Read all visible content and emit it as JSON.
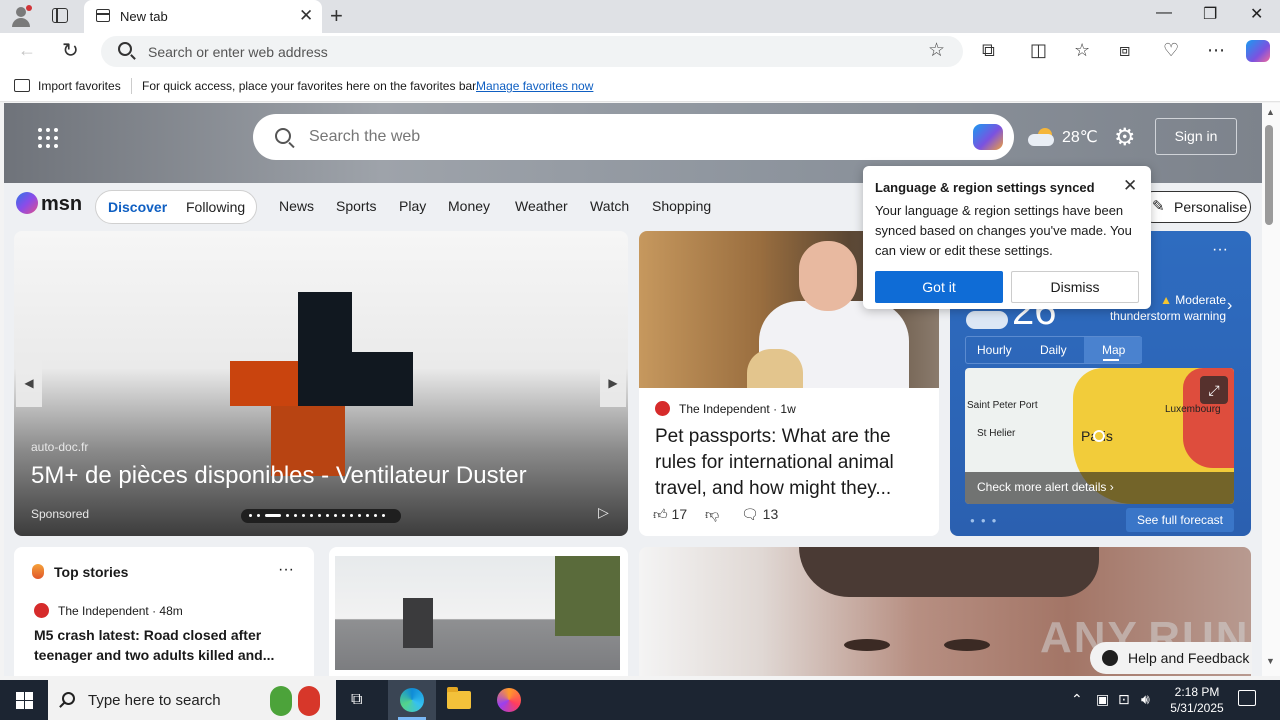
{
  "browser": {
    "tab": {
      "label": "New tab",
      "close": "✕"
    },
    "new_tab": "+",
    "window_controls": {
      "minimize": "—",
      "restore": "❐",
      "close": "✕"
    },
    "address": {
      "placeholder": "Search or enter web address"
    },
    "favorites_bar": {
      "import_label": "Import favorites",
      "message": "For quick access, place your favorites here on the favorites bar.",
      "manage_link": "Manage favorites now"
    },
    "toolbar_icons": [
      "extensions-icon",
      "split-screen-icon",
      "favorites-icon",
      "collections-icon",
      "browser-essentials-icon",
      "more-icon",
      "copilot-icon"
    ]
  },
  "msn": {
    "search_placeholder": "Search the web",
    "weather_temp": "28℃",
    "sign_in": "Sign in",
    "logo": "msn",
    "tabs": {
      "discover": "Discover",
      "following": "Following"
    },
    "nav": [
      "News",
      "Sports",
      "Play",
      "Money",
      "Weather",
      "Watch",
      "Shopping"
    ],
    "personalise": "Personalise"
  },
  "carousel": {
    "source": "auto-doc.fr",
    "title": "5M+ de pièces disponibles - Ventilateur Duster",
    "sponsored": "Sponsored",
    "slide_count": 16,
    "active_slide": 2
  },
  "article": {
    "source": "The Independent",
    "age": "1w",
    "title": "Pet passports: What are the rules for international animal travel, and how might they...",
    "likes": "17",
    "comments": "13"
  },
  "weather_card": {
    "more": "···",
    "temp": "26",
    "alert": "Moderate thunderstorm warning",
    "tabs": [
      "Hourly",
      "Daily",
      "Map"
    ],
    "selected_tab": "Map",
    "map_labels": [
      "Saint Peter Port",
      "St Helier",
      "Paris",
      "Luxembourg"
    ],
    "check_alerts": "Check more alert details ›",
    "see_forecast": "See full forecast"
  },
  "popup": {
    "title": "Language & region settings synced",
    "body": "Your language & region settings have been synced based on changes you've made. You can view or edit these settings.",
    "got_it": "Got it",
    "dismiss": "Dismiss"
  },
  "top_stories": {
    "title": "Top stories",
    "more": "···",
    "source": "The Independent · 48m",
    "headline": "M5 crash latest: Road closed after teenager and two adults killed and..."
  },
  "help": "Help and Feedback",
  "watermark": "ANY.RUN",
  "taskbar": {
    "search_placeholder": "Type here to search",
    "time": "2:18 PM",
    "date": "5/31/2025"
  }
}
